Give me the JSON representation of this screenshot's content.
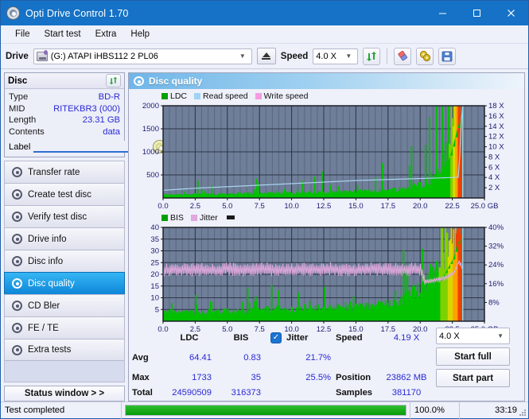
{
  "window": {
    "title": "Opti Drive Control 1.70",
    "icon": "disc-icon",
    "minimize": "minimize-icon",
    "maximize": "maximize-icon",
    "close": "close-icon"
  },
  "menu": {
    "items": [
      "File",
      "Start test",
      "Extra",
      "Help"
    ]
  },
  "toolbar": {
    "drive_label": "Drive",
    "drive_value": "(G:)  ATAPI iHBS112  2 PL06",
    "eject_icon": "eject-icon",
    "speed_label": "Speed",
    "speed_value": "4.0 X",
    "refresh_icon": "refresh-icon",
    "eraser_icon": "eraser-icon",
    "settings_icon": "gear-icon",
    "save_icon": "save-icon"
  },
  "disc_panel": {
    "header": "Disc",
    "refresh_icon": "refresh-icon",
    "rows": [
      {
        "key": "Type",
        "value": "BD-R"
      },
      {
        "key": "MID",
        "value": "RITEKBR3 (000)"
      },
      {
        "key": "Length",
        "value": "23.31 GB"
      },
      {
        "key": "Contents",
        "value": "data"
      }
    ],
    "label_key": "Label",
    "label_value": "",
    "label_placeholder": "",
    "disc_icon": "cd-icon"
  },
  "sidebar": {
    "items": [
      {
        "label": "Transfer rate",
        "icon": "disc-icon",
        "active": false
      },
      {
        "label": "Create test disc",
        "icon": "disc-icon",
        "active": false
      },
      {
        "label": "Verify test disc",
        "icon": "disc-icon",
        "active": false
      },
      {
        "label": "Drive info",
        "icon": "disc-icon",
        "active": false
      },
      {
        "label": "Disc info",
        "icon": "disc-icon",
        "active": false
      },
      {
        "label": "Disc quality",
        "icon": "disc-icon",
        "active": true
      },
      {
        "label": "CD Bler",
        "icon": "disc-icon",
        "active": false
      },
      {
        "label": "FE / TE",
        "icon": "disc-icon",
        "active": false
      },
      {
        "label": "Extra tests",
        "icon": "disc-icon",
        "active": false
      }
    ],
    "status_window_button": "Status window > >"
  },
  "main": {
    "header": "Disc quality",
    "header_icon": "disc-icon"
  },
  "stats": {
    "col_headers": [
      "LDC",
      "BIS"
    ],
    "rows": [
      {
        "label": "Avg",
        "ldc": "64.41",
        "bis": "0.83",
        "jitter": "21.7%"
      },
      {
        "label": "Max",
        "ldc": "1733",
        "bis": "35",
        "jitter": "25.5%"
      },
      {
        "label": "Total",
        "ldc": "24590509",
        "bis": "316373",
        "jitter": ""
      }
    ],
    "jitter_label": "Jitter",
    "jitter_checked": true,
    "jitter_check_icon": "check-icon",
    "speed_label": "Speed",
    "speed_value": "4.19 X",
    "position_label": "Position",
    "position_value": "23862 MB",
    "samples_label": "Samples",
    "samples_value": "381170",
    "speed_select": "4.0 X",
    "start_full_button": "Start full",
    "start_part_button": "Start part"
  },
  "statusbar": {
    "message": "Test completed",
    "percent_text": "100.0%",
    "percent_value": 100,
    "elapsed": "33:19",
    "resize_grip": "resize-grip-icon"
  },
  "colors": {
    "ldc_green": "#00c000",
    "read_speed_blue": "#aad4f0",
    "write_speed_pink": "#f59ce0",
    "bis_green": "#00c000",
    "jitter_pink": "#e0a8dc",
    "plot_bg": "#6f7e99",
    "grid": "#3a4558",
    "accent_blue": "#1572c6",
    "value_blue": "#2a2ad4"
  },
  "chart_data": [
    {
      "type": "area",
      "id": "disc-quality-ldc-chart",
      "title": "",
      "xlabel": "GB",
      "ylabel": "LDC",
      "xlim": [
        0,
        25.0
      ],
      "ylim": [
        0,
        2000
      ],
      "y2lim": [
        0,
        18
      ],
      "y2label": "X",
      "grid": true,
      "legend_position": "top-left",
      "xticks": [
        0.0,
        2.5,
        5.0,
        7.5,
        10.0,
        12.5,
        15.0,
        17.5,
        20.0,
        22.5,
        25.0
      ],
      "xticklabels": [
        "0.0",
        "2.5",
        "5.0",
        "7.5",
        "10.0",
        "12.5",
        "15.0",
        "17.5",
        "20.0",
        "22.5",
        "25.0 GB"
      ],
      "yticks": [
        500,
        1000,
        1500,
        2000
      ],
      "yticklabels": [
        "500",
        "1000",
        "1500",
        "2000"
      ],
      "y2ticks": [
        2,
        4,
        6,
        8,
        10,
        12,
        14,
        16,
        18
      ],
      "y2ticklabels": [
        "2 X",
        "4 X",
        "6 X",
        "8 X",
        "10 X",
        "12 X",
        "14 X",
        "16 X",
        "18 X"
      ],
      "series": [
        {
          "name": "LDC",
          "color": "#00c000",
          "kind": "area",
          "axis": "left",
          "x": [
            0.0,
            0.5,
            1.0,
            1.5,
            2.0,
            2.5,
            3.0,
            3.5,
            4.0,
            4.5,
            5.0,
            5.5,
            6.0,
            6.5,
            7.0,
            7.5,
            8.0,
            8.5,
            9.0,
            9.5,
            10.0,
            10.5,
            11.0,
            11.5,
            12.0,
            12.5,
            13.0,
            13.5,
            14.0,
            14.5,
            15.0,
            15.5,
            16.0,
            16.5,
            17.0,
            17.5,
            18.0,
            18.5,
            19.0,
            19.5,
            20.0,
            20.5,
            21.0,
            21.5,
            22.0,
            22.3,
            22.6,
            22.9,
            23.1,
            23.31
          ],
          "values": [
            40,
            45,
            48,
            45,
            50,
            48,
            52,
            50,
            55,
            52,
            58,
            55,
            60,
            58,
            62,
            60,
            65,
            62,
            68,
            65,
            70,
            68,
            72,
            70,
            75,
            72,
            78,
            75,
            82,
            80,
            85,
            88,
            92,
            95,
            100,
            108,
            118,
            130,
            145,
            165,
            195,
            240,
            310,
            420,
            640,
            880,
            1180,
            1500,
            1690,
            1733
          ]
        },
        {
          "name": "Read speed",
          "color": "#aad4f0",
          "kind": "line",
          "axis": "right",
          "x": [
            0.0,
            2.5,
            5.0,
            7.5,
            10.0,
            12.5,
            15.0,
            17.5,
            20.0,
            22.0,
            23.0,
            23.25,
            23.31
          ],
          "values": [
            1.5,
            1.9,
            2.2,
            2.5,
            2.8,
            3.1,
            3.4,
            3.6,
            3.8,
            3.95,
            4.05,
            17.9,
            17.9
          ]
        },
        {
          "name": "Write speed",
          "color": "#f59ce0",
          "kind": "line",
          "axis": "right",
          "x": [],
          "values": []
        }
      ]
    },
    {
      "type": "area",
      "id": "disc-quality-bis-chart",
      "title": "",
      "xlabel": "GB",
      "ylabel": "BIS",
      "xlim": [
        0,
        25.0
      ],
      "ylim": [
        0,
        40
      ],
      "y2lim": [
        0,
        40
      ],
      "y2label": "%",
      "grid": true,
      "legend_position": "top-left",
      "xticks": [
        0.0,
        2.5,
        5.0,
        7.5,
        10.0,
        12.5,
        15.0,
        17.5,
        20.0,
        22.5,
        25.0
      ],
      "xticklabels": [
        "0.0",
        "2.5",
        "5.0",
        "7.5",
        "10.0",
        "12.5",
        "15.0",
        "17.5",
        "20.0",
        "22.5",
        "25.0 GB"
      ],
      "yticks": [
        5,
        10,
        15,
        20,
        25,
        30,
        35,
        40
      ],
      "yticklabels": [
        "5",
        "10",
        "15",
        "20",
        "25",
        "30",
        "35",
        "40"
      ],
      "y2ticks": [
        8,
        16,
        24,
        32,
        40
      ],
      "y2ticklabels": [
        "8%",
        "16%",
        "24%",
        "32%",
        "40%"
      ],
      "series": [
        {
          "name": "BIS",
          "color": "#00c000",
          "kind": "area",
          "axis": "left",
          "x": [
            0.0,
            0.5,
            1.0,
            1.5,
            2.0,
            2.5,
            3.0,
            3.5,
            4.0,
            4.5,
            5.0,
            5.5,
            6.0,
            6.5,
            7.0,
            7.5,
            8.0,
            8.5,
            9.0,
            9.5,
            10.0,
            10.5,
            11.0,
            11.5,
            12.0,
            12.5,
            13.0,
            13.5,
            14.0,
            14.5,
            15.0,
            15.5,
            16.0,
            16.5,
            17.0,
            17.5,
            18.0,
            18.5,
            19.0,
            19.5,
            20.0,
            20.5,
            21.0,
            21.5,
            22.0,
            22.3,
            22.6,
            22.9,
            23.1,
            23.31
          ],
          "values": [
            2.0,
            2.1,
            2.2,
            2.0,
            2.3,
            2.1,
            2.4,
            2.2,
            2.5,
            2.3,
            2.6,
            2.4,
            2.7,
            2.5,
            2.8,
            2.6,
            2.9,
            2.7,
            3.0,
            2.8,
            3.1,
            2.9,
            3.2,
            3.0,
            3.3,
            3.1,
            3.4,
            3.2,
            3.6,
            3.4,
            3.7,
            3.9,
            4.1,
            4.3,
            4.6,
            5.0,
            5.5,
            6.1,
            6.8,
            7.8,
            9.0,
            11.0,
            13.5,
            16.5,
            21.0,
            24.0,
            27.0,
            33.0,
            34.5,
            35.0
          ]
        },
        {
          "name": "Jitter",
          "color": "#e0a8dc",
          "kind": "line",
          "axis": "right",
          "x": [
            0.0,
            1.0,
            2.0,
            3.0,
            4.0,
            5.0,
            6.0,
            7.0,
            8.0,
            9.0,
            10.0,
            11.0,
            12.0,
            13.0,
            14.0,
            15.0,
            16.0,
            17.0,
            18.0,
            19.0,
            20.0,
            20.4,
            21.0,
            21.5,
            22.0,
            22.5,
            22.8,
            23.0,
            23.2,
            23.31
          ],
          "values": [
            21.5,
            22.0,
            21.8,
            22.2,
            21.6,
            22.4,
            21.9,
            22.1,
            22.3,
            21.7,
            22.0,
            22.2,
            21.8,
            22.4,
            22.0,
            21.9,
            22.3,
            22.1,
            22.0,
            22.2,
            22.1,
            17.0,
            17.3,
            17.8,
            18.5,
            20.0,
            22.5,
            25.5,
            24.0,
            23.0
          ]
        }
      ]
    }
  ]
}
